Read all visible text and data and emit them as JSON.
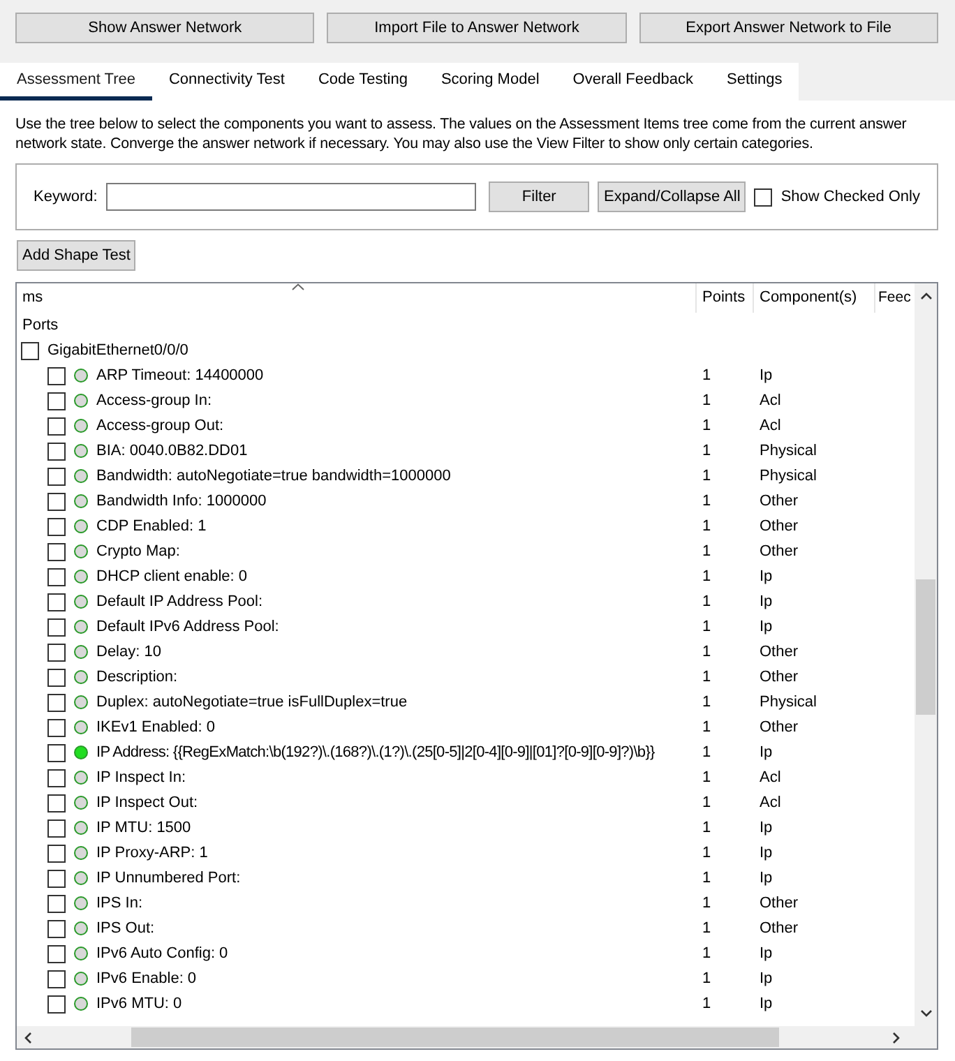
{
  "top_buttons": [
    "Show Answer Network",
    "Import File to Answer Network",
    "Export Answer Network to File"
  ],
  "tabs": [
    {
      "label": "Assessment Tree",
      "selected": true
    },
    {
      "label": "Connectivity Test",
      "selected": false
    },
    {
      "label": "Code Testing",
      "selected": false
    },
    {
      "label": "Scoring Model",
      "selected": false
    },
    {
      "label": "Overall Feedback",
      "selected": false
    },
    {
      "label": "Settings",
      "selected": false
    }
  ],
  "description": "Use the tree below to select the components you want to assess. The values on the Assessment Items tree come from the current answer network state. Converge the answer network if necessary. You may also use the View Filter to show only certain categories.",
  "filter": {
    "label": "Keyword:",
    "button": "Filter",
    "expand_button": "Expand/Collapse All",
    "show_checked": {
      "label": "Show Checked Only",
      "checked": false
    }
  },
  "add_button": "Add Shape Test",
  "table": {
    "columns": [
      "ms",
      "Points",
      "Component(s)",
      "Feec"
    ],
    "tree": [
      {
        "label": "Ports",
        "children": [
          {
            "label": "GigabitEthernet0/0/0",
            "checked": false,
            "children": [
              {
                "label": "ARP Timeout: 14400000",
                "checked": false,
                "active": false,
                "points": "1",
                "component": "Ip"
              },
              {
                "label": "Access-group In:",
                "checked": false,
                "active": false,
                "points": "1",
                "component": "Acl"
              },
              {
                "label": "Access-group Out:",
                "checked": false,
                "active": false,
                "points": "1",
                "component": "Acl"
              },
              {
                "label": "BIA: 0040.0B82.DD01",
                "checked": false,
                "active": false,
                "points": "1",
                "component": "Physical"
              },
              {
                "label": "Bandwidth: autoNegotiate=true bandwidth=1000000",
                "checked": false,
                "active": false,
                "points": "1",
                "component": "Physical"
              },
              {
                "label": "Bandwidth Info: 1000000",
                "checked": false,
                "active": false,
                "points": "1",
                "component": "Other"
              },
              {
                "label": "CDP Enabled: 1",
                "checked": false,
                "active": false,
                "points": "1",
                "component": "Other"
              },
              {
                "label": "Crypto Map:",
                "checked": false,
                "active": false,
                "points": "1",
                "component": "Other"
              },
              {
                "label": "DHCP client enable: 0",
                "checked": false,
                "active": false,
                "points": "1",
                "component": "Ip"
              },
              {
                "label": "Default IP Address Pool:",
                "checked": false,
                "active": false,
                "points": "1",
                "component": "Ip"
              },
              {
                "label": "Default IPv6 Address Pool:",
                "checked": false,
                "active": false,
                "points": "1",
                "component": "Ip"
              },
              {
                "label": "Delay: 10",
                "checked": false,
                "active": false,
                "points": "1",
                "component": "Other"
              },
              {
                "label": "Description:",
                "checked": false,
                "active": false,
                "points": "1",
                "component": "Other"
              },
              {
                "label": "Duplex: autoNegotiate=true isFullDuplex=true",
                "checked": false,
                "active": false,
                "points": "1",
                "component": "Physical"
              },
              {
                "label": "IKEv1 Enabled: 0",
                "checked": false,
                "active": false,
                "points": "1",
                "component": "Other"
              },
              {
                "label": "IP Address: {{RegExMatch:\\b(192?)\\.(168?)\\.(1?)\\.(25[0-5]|2[0-4][0-9]|[01]?[0-9][0-9]?)\\b}}",
                "checked": false,
                "active": true,
                "points": "1",
                "component": "Ip"
              },
              {
                "label": "IP Inspect In:",
                "checked": false,
                "active": false,
                "points": "1",
                "component": "Acl"
              },
              {
                "label": "IP Inspect Out:",
                "checked": false,
                "active": false,
                "points": "1",
                "component": "Acl"
              },
              {
                "label": "IP MTU: 1500",
                "checked": false,
                "active": false,
                "points": "1",
                "component": "Ip"
              },
              {
                "label": "IP Proxy-ARP: 1",
                "checked": false,
                "active": false,
                "points": "1",
                "component": "Ip"
              },
              {
                "label": "IP Unnumbered Port:",
                "checked": false,
                "active": false,
                "points": "1",
                "component": "Ip"
              },
              {
                "label": "IPS In:",
                "checked": false,
                "active": false,
                "points": "1",
                "component": "Other"
              },
              {
                "label": "IPS Out:",
                "checked": false,
                "active": false,
                "points": "1",
                "component": "Other"
              },
              {
                "label": "IPv6 Auto Config: 0",
                "checked": false,
                "active": false,
                "points": "1",
                "component": "Ip"
              },
              {
                "label": "IPv6 Enable: 0",
                "checked": false,
                "active": false,
                "points": "1",
                "component": "Ip"
              },
              {
                "label": "IPv6 MTU: 0",
                "checked": false,
                "active": false,
                "points": "1",
                "component": "Ip"
              }
            ]
          }
        ]
      }
    ]
  }
}
